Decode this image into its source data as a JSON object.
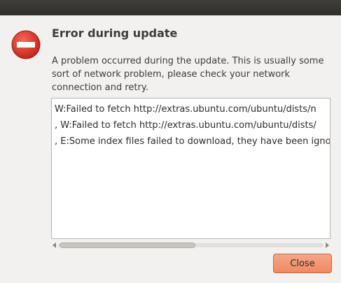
{
  "dialog": {
    "title": "Error during update",
    "message": "A problem occurred during the update. This is usually some sort of network problem, please check your network connection and retry.",
    "icon": "error-icon",
    "details_lines": [
      "W:Failed to fetch http://extras.ubuntu.com/ubuntu/dists/n",
      ", W:Failed to fetch http://extras.ubuntu.com/ubuntu/dists/",
      ", E:Some index files failed to download, they have been igno"
    ],
    "close_label": "Close"
  },
  "colors": {
    "accent_button": "#ee8a64",
    "error_red": "#d92b1f",
    "titlebar": "#3a3935"
  }
}
